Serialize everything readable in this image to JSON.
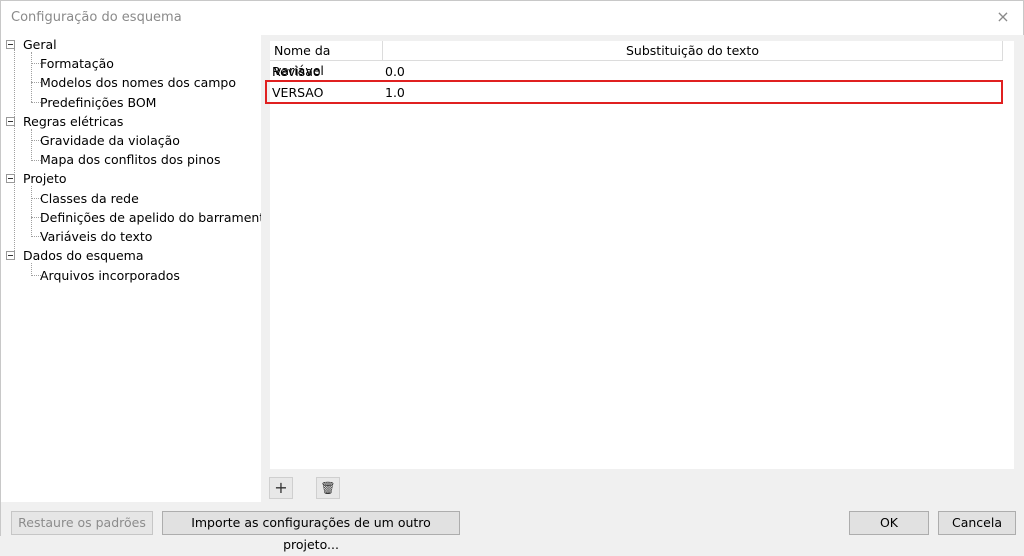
{
  "window": {
    "title": "Configuração do esquema",
    "close_icon": "×"
  },
  "tree": {
    "groups": [
      {
        "label": "Geral",
        "children": [
          "Formatação",
          "Modelos dos nomes dos campo",
          "Predefinições BOM"
        ]
      },
      {
        "label": "Regras elétricas",
        "children": [
          "Gravidade da violação",
          "Mapa dos conflitos dos pinos"
        ]
      },
      {
        "label": "Projeto",
        "children": [
          "Classes da rede",
          "Definições de apelido do barramento",
          "Variáveis do texto"
        ]
      },
      {
        "label": "Dados do esquema",
        "children": [
          "Arquivos incorporados"
        ]
      }
    ]
  },
  "table": {
    "headers": [
      "Nome da variável",
      "Substituição do texto"
    ],
    "rows": [
      {
        "name": "Revisao",
        "value": "0.0"
      },
      {
        "name": "VERSAO",
        "value": "1.0"
      }
    ],
    "highlight_color": "#e02020"
  },
  "toolbar": {
    "add_icon": "+",
    "delete_icon": "🗑"
  },
  "footer": {
    "restore_label": "Restaure os padrões",
    "import_label": "Importe as configurações de um outro projeto...",
    "ok_label": "OK",
    "cancel_label": "Cancela"
  }
}
